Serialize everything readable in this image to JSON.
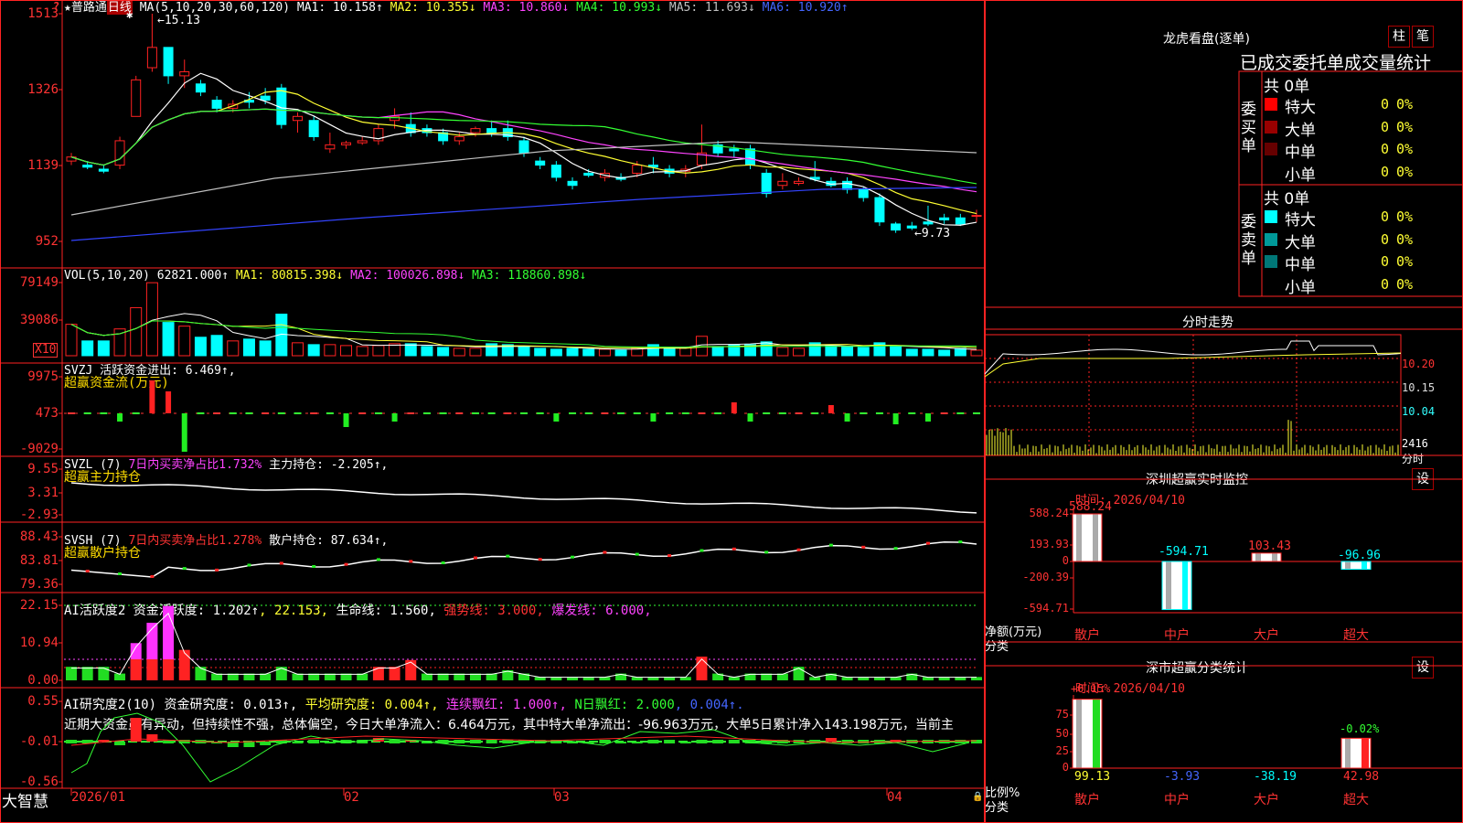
{
  "price_panel": {
    "stock_name": "普路通",
    "period": "日线",
    "ma_label": "MA(5,10,20,30,60,120)",
    "ma1": "MA1: 10.158↑",
    "ma2": "MA2: 10.355↓",
    "ma3": "MA3: 10.860↓",
    "ma4": "MA4: 10.993↓",
    "ma5": "MA5: 11.693↓",
    "ma6": "MA6: 10.920↑",
    "axis_ticks": [
      "1513",
      "1326",
      "1139",
      "952"
    ],
    "high_note": "15.13",
    "low_note": "9.73",
    "q_mark": "?"
  },
  "vol_panel": {
    "label": "VOL(5,10,20)",
    "value": "62821.000↑",
    "ma1": "MA1: 80815.398↓",
    "ma2": "MA2: 100026.898↓",
    "ma3": "MA3: 118860.898↓",
    "axis_ticks": [
      "79149",
      "39086"
    ],
    "unit": "X10"
  },
  "svzj_panel": {
    "label": "SVZJ  活跃资金进出: 6.469↑,",
    "sub": "超赢资金流(万元)",
    "axis_ticks": [
      "9975",
      "473",
      "-9029"
    ]
  },
  "svzl_panel": {
    "prefix": "SVZL (7)",
    "ratio": "7日内买卖净占比1.732%",
    "hold": "主力持仓: -2.205↑,",
    "sub": "超赢主力持仓",
    "axis_ticks": [
      "9.55",
      "3.31",
      "-2.93"
    ]
  },
  "svsh_panel": {
    "prefix": "SVSH (7)",
    "ratio": "7日内买卖净占比1.278%",
    "hold": "散户持仓: 87.634↑,",
    "sub": "超赢散户持仓",
    "axis_ticks": [
      "88.43",
      "83.81",
      "79.36"
    ]
  },
  "ai_active_panel": {
    "prefix": "AI活跃度2",
    "act": "资金活跃度: 1.202↑",
    "val2": "22.153",
    "life": "生命线: 1.560",
    "strong": "强势线: 3.000",
    "burst": "爆发线: 6.000",
    "axis_ticks": [
      "22.15",
      "10.94",
      "0.00"
    ]
  },
  "ai_research_panel": {
    "prefix": "AI研究度2(10)",
    "res": "资金研究度: 0.013↑",
    "avg": "平均研究度: 0.004↑",
    "cont": "连续飘红: 1.000↑",
    "n": "N日飘红: 2.000",
    "tail": "0.004↑",
    "commentary": "近期大资金虽有异动，但持续性不强，总体偏空，今日大单净流入：6.464万元，其中特大单净流出：-96.963万元，大单5日累计净入143.198万元，当前主",
    "axis_ticks": [
      "0.55",
      "-0.01",
      "-0.56"
    ]
  },
  "date_axis": {
    "brand": "大智慧",
    "labels": [
      "2026/01",
      "02",
      "03",
      "04"
    ]
  },
  "longhu": {
    "title": "龙虎看盘(逐单)",
    "btn1": "柱",
    "btn2": "笔",
    "table_title": "已成交委托单成交量统计",
    "buy_label": "委买单",
    "sell_label": "委卖单",
    "buy_total": "共 0单",
    "sell_total": "共 0单",
    "buy_rows": [
      {
        "label": "特大",
        "count": "0",
        "pct": "0%",
        "color": "#ff0000"
      },
      {
        "label": "大单",
        "count": "0",
        "pct": "0%",
        "color": "#990000"
      },
      {
        "label": "中单",
        "count": "0",
        "pct": "0%",
        "color": "#660000"
      },
      {
        "label": "小单",
        "count": "0",
        "pct": "0%",
        "color": ""
      }
    ],
    "sell_rows": [
      {
        "label": "特大",
        "count": "0",
        "pct": "0%",
        "color": "#00ffff"
      },
      {
        "label": "大单",
        "count": "0",
        "pct": "0%",
        "color": "#009999"
      },
      {
        "label": "中单",
        "count": "0",
        "pct": "0%",
        "color": "#007777"
      },
      {
        "label": "小单",
        "count": "0",
        "pct": "0%",
        "color": ""
      }
    ]
  },
  "intraday": {
    "title": "分时走势",
    "price_ticks": [
      "10.20",
      "10.15",
      "10.04"
    ],
    "vol_tick": "2416",
    "hands": "分时"
  },
  "monitor": {
    "title": "深圳超赢实时监控",
    "set": "设",
    "time": "时间: 2026/04/10",
    "axis_ticks": [
      "588.24",
      "193.93",
      "0",
      "-200.39",
      "-594.71"
    ],
    "ylabel1": "净额(万元)",
    "ylabel2": "分类",
    "categories": [
      "散户",
      "中户",
      "大户",
      "超大"
    ],
    "values": [
      588.24,
      -594.71,
      103.43,
      -96.96
    ],
    "value_labels": [
      "588.24",
      "-594.71",
      "103.43",
      "-96.96"
    ]
  },
  "classify": {
    "title": "深市超赢分类统计",
    "set": "设",
    "time": "时间: 2026/04/10",
    "axis_ticks": [
      "75",
      "50",
      "25",
      "0"
    ],
    "ylabel1": "比例%",
    "ylabel2": "分类",
    "categories": [
      "散户",
      "中户",
      "大户",
      "超大"
    ],
    "values": [
      99.13,
      -3.93,
      -38.19,
      42.98
    ],
    "value_labels": [
      "99.13",
      "-3.93",
      "-38.19",
      "42.98"
    ],
    "change_labels": [
      "+0.15%",
      "",
      "",
      "-0.02%"
    ]
  },
  "chart_data": [
    {
      "type": "candlestick",
      "title": "普路通 日线",
      "ylabel": "",
      "ylim": [
        9.5,
        15.3
      ],
      "note": "daily candles, prices ×100 on axis ticks",
      "candles": [
        [
          11.5,
          11.7,
          11.4,
          11.6
        ],
        [
          11.4,
          11.5,
          11.3,
          11.35
        ],
        [
          11.3,
          11.4,
          11.2,
          11.25
        ],
        [
          11.4,
          12.1,
          11.3,
          12.0
        ],
        [
          12.6,
          13.6,
          12.6,
          13.5
        ],
        [
          13.8,
          15.13,
          13.7,
          14.3
        ],
        [
          14.3,
          14.3,
          13.4,
          13.6
        ],
        [
          13.6,
          14.0,
          13.3,
          13.7
        ],
        [
          13.4,
          13.5,
          13.1,
          13.2
        ],
        [
          13.0,
          13.1,
          12.7,
          12.8
        ],
        [
          12.8,
          13.0,
          12.7,
          12.9
        ],
        [
          13.0,
          13.2,
          12.8,
          12.95
        ],
        [
          13.1,
          13.3,
          12.9,
          13.0
        ],
        [
          13.3,
          13.4,
          12.3,
          12.4
        ],
        [
          12.5,
          12.7,
          12.2,
          12.6
        ],
        [
          12.5,
          12.6,
          12.0,
          12.1
        ],
        [
          11.8,
          12.2,
          11.7,
          11.9
        ],
        [
          11.9,
          12.0,
          11.8,
          11.95
        ],
        [
          11.95,
          12.1,
          11.9,
          12.0
        ],
        [
          12.0,
          12.4,
          11.9,
          12.3
        ],
        [
          12.5,
          12.8,
          12.3,
          12.6
        ],
        [
          12.4,
          12.7,
          12.1,
          12.2
        ],
        [
          12.3,
          12.4,
          12.1,
          12.2
        ],
        [
          12.2,
          12.3,
          11.9,
          12.0
        ],
        [
          12.0,
          12.2,
          11.9,
          12.1
        ],
        [
          12.2,
          12.35,
          12.1,
          12.3
        ],
        [
          12.3,
          12.5,
          12.1,
          12.2
        ],
        [
          12.3,
          12.5,
          12.0,
          12.1
        ],
        [
          12.0,
          12.1,
          11.6,
          11.7
        ],
        [
          11.5,
          11.6,
          11.3,
          11.4
        ],
        [
          11.4,
          11.5,
          11.0,
          11.1
        ],
        [
          11.0,
          11.1,
          10.8,
          10.9
        ],
        [
          11.2,
          11.3,
          11.1,
          11.15
        ],
        [
          11.1,
          11.3,
          11.0,
          11.2
        ],
        [
          11.1,
          11.2,
          11.0,
          11.05
        ],
        [
          11.2,
          11.5,
          11.1,
          11.4
        ],
        [
          11.4,
          11.6,
          11.2,
          11.35
        ],
        [
          11.3,
          11.4,
          11.1,
          11.2
        ],
        [
          11.25,
          11.4,
          11.1,
          11.3
        ],
        [
          11.4,
          12.4,
          11.3,
          11.7
        ],
        [
          11.9,
          12.0,
          11.6,
          11.7
        ],
        [
          11.8,
          11.9,
          11.6,
          11.75
        ],
        [
          11.8,
          11.9,
          11.3,
          11.4
        ],
        [
          11.2,
          11.3,
          10.6,
          10.7
        ],
        [
          10.9,
          11.2,
          10.8,
          11.0
        ],
        [
          10.95,
          11.1,
          10.9,
          11.0
        ],
        [
          11.1,
          11.5,
          11.0,
          11.05
        ],
        [
          11.0,
          11.1,
          10.85,
          10.9
        ],
        [
          11.0,
          11.1,
          10.7,
          10.8
        ],
        [
          10.8,
          10.85,
          10.5,
          10.6
        ],
        [
          10.6,
          10.7,
          9.9,
          10.0
        ],
        [
          9.95,
          10.0,
          9.73,
          9.8
        ],
        [
          9.9,
          10.0,
          9.8,
          9.85
        ],
        [
          10.0,
          10.4,
          9.9,
          9.95
        ],
        [
          10.1,
          10.2,
          9.95,
          10.05
        ],
        [
          10.1,
          10.2,
          9.9,
          9.95
        ],
        [
          10.15,
          10.3,
          10.0,
          10.16
        ]
      ]
    },
    {
      "type": "bar",
      "title": "VOL",
      "note": "volume ×10 hands",
      "values": [
        3.4,
        1.6,
        1.6,
        2.9,
        5.2,
        7.9,
        3.6,
        3.2,
        2.0,
        2.2,
        1.6,
        1.8,
        1.6,
        4.5,
        1.4,
        1.2,
        1.2,
        1.1,
        1.0,
        1.1,
        1.3,
        1.3,
        1.0,
        0.9,
        0.8,
        0.8,
        1.3,
        1.2,
        1.0,
        0.8,
        0.7,
        0.8,
        0.7,
        0.7,
        0.6,
        0.8,
        1.2,
        0.9,
        0.9,
        2.1,
        1.0,
        1.2,
        1.2,
        1.5,
        0.9,
        0.8,
        1.4,
        1.1,
        1.0,
        0.9,
        1.4,
        1.0,
        0.7,
        0.7,
        0.6,
        0.8,
        0.6
      ]
    }
  ]
}
